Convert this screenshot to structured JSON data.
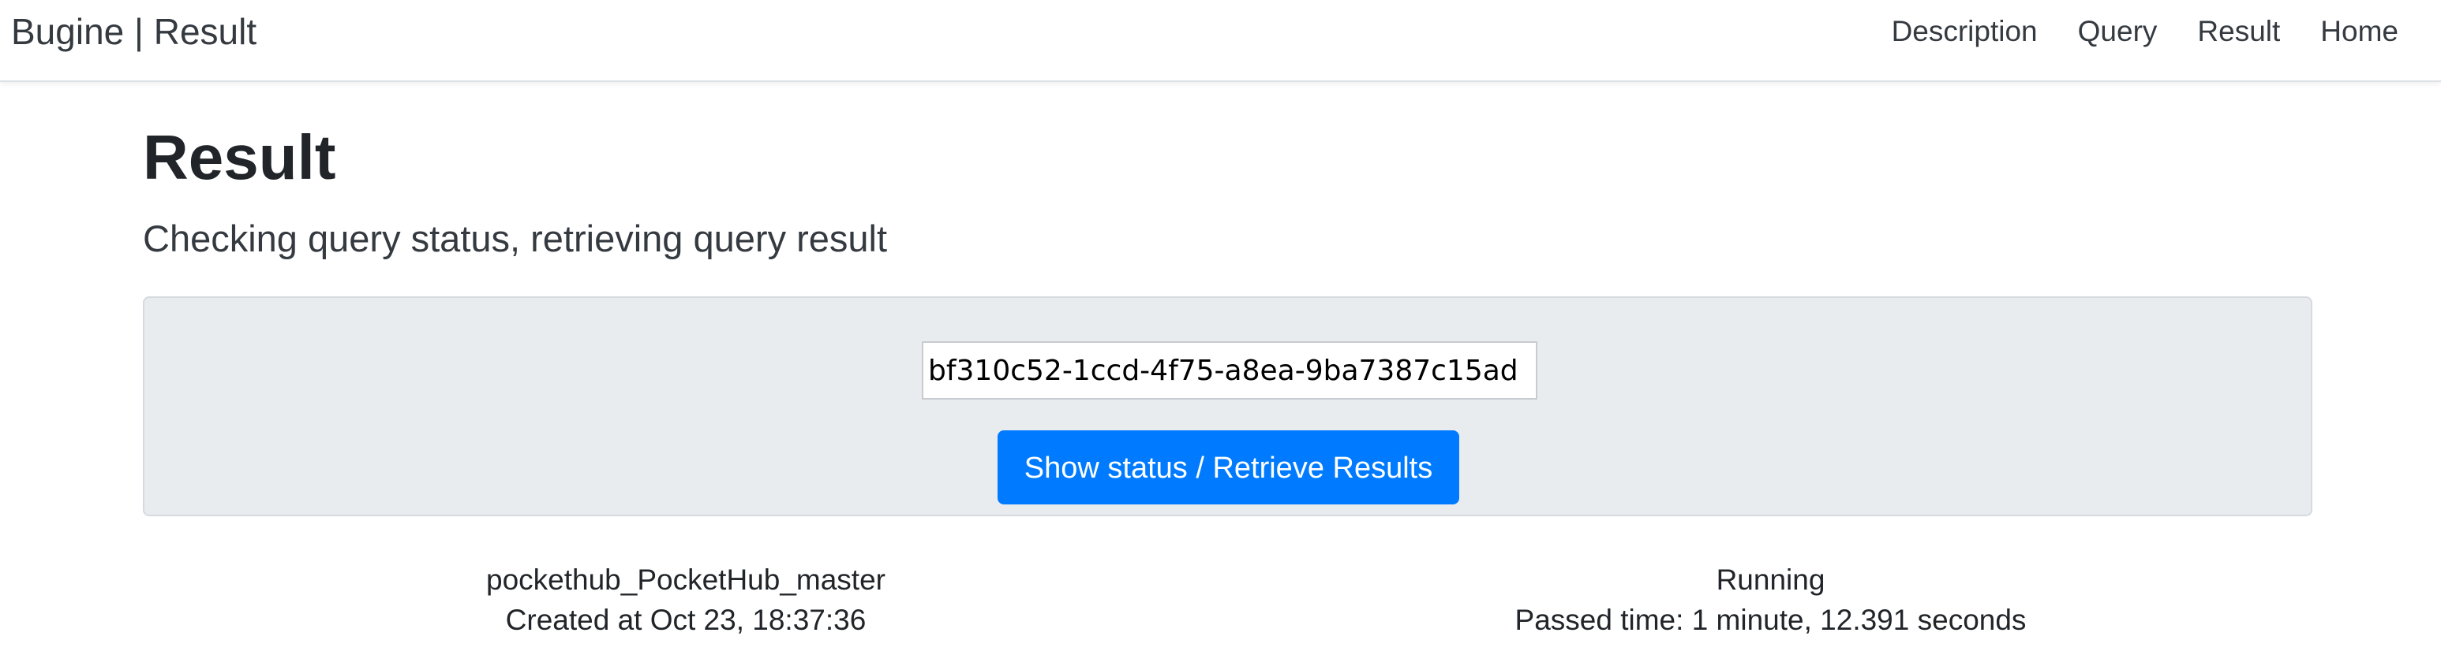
{
  "navbar": {
    "brand": "Bugine | Result",
    "links": [
      "Description",
      "Query",
      "Result",
      "Home"
    ]
  },
  "main": {
    "title": "Result",
    "lead": "Checking query status, retrieving query result"
  },
  "query_form": {
    "query_id_value": "bf310c52-1ccd-4f75-a8ea-9ba7387c15ad",
    "submit_label": "Show status / Retrieve Results"
  },
  "result": {
    "project_name": "pockethub_PocketHub_master",
    "created_at": "Created at Oct 23, 18:37:36",
    "status": "Running",
    "passed_time": "Passed time: 1 minute, 12.391 seconds"
  }
}
